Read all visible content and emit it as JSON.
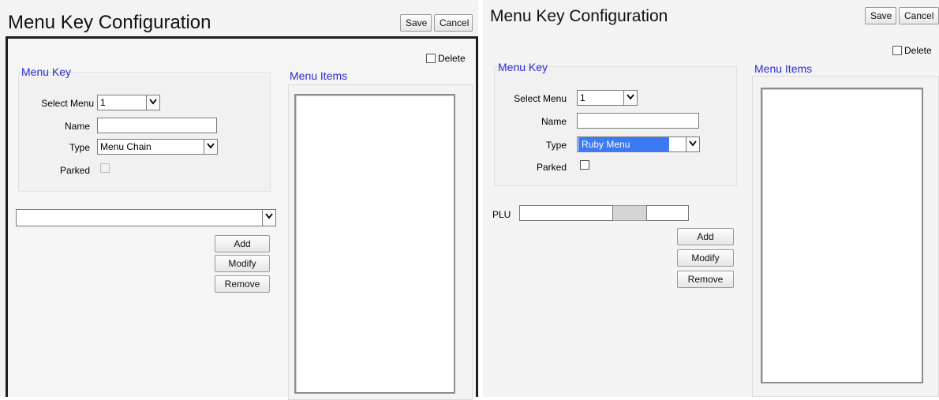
{
  "left": {
    "title": "Menu Key Configuration",
    "save_label": "Save",
    "cancel_label": "Cancel",
    "delete_label": "Delete",
    "delete_checked": false,
    "menu_key_group": {
      "title": "Menu Key",
      "select_menu_label": "Select Menu",
      "select_menu_value": "1",
      "name_label": "Name",
      "name_value": "",
      "type_label": "Type",
      "type_value": "Menu Chain",
      "parked_label": "Parked",
      "parked_checked": false
    },
    "chain_select_value": "",
    "add_label": "Add",
    "modify_label": "Modify",
    "remove_label": "Remove",
    "menu_items_title": "Menu Items"
  },
  "right": {
    "title": "Menu Key Configuration",
    "save_label": "Save",
    "cancel_label": "Cancel",
    "delete_label": "Delete",
    "delete_checked": false,
    "menu_key_group": {
      "title": "Menu Key",
      "select_menu_label": "Select Menu",
      "select_menu_value": "1",
      "name_label": "Name",
      "name_value": "",
      "type_label": "Type",
      "type_value": "Ruby Menu",
      "parked_label": "Parked",
      "parked_checked": false
    },
    "plu_label": "PLU",
    "plu_value_1": "",
    "plu_value_2": "",
    "add_label": "Add",
    "modify_label": "Modify",
    "remove_label": "Remove",
    "menu_items_title": "Menu Items"
  },
  "colors": {
    "group_title": "#2b2bd6",
    "selection_highlight": "#3b79f5",
    "frame_border": "#1e1e1e"
  },
  "icons": {
    "dropdown": "chevron-down-icon",
    "checkbox": "checkbox-icon"
  }
}
